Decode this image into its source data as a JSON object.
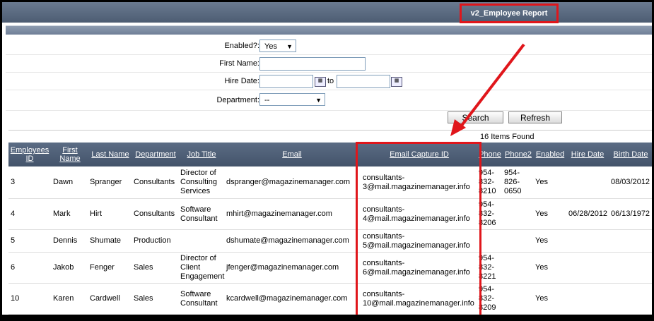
{
  "header": {
    "title": "v2_Employee Report"
  },
  "filters": {
    "enabled_label": "Enabled?:",
    "enabled_value": "Yes",
    "first_name_label": "First Name:",
    "first_name_value": "",
    "hire_date_label": "Hire Date:",
    "hire_date_from": "",
    "hire_date_to_label": "to",
    "hire_date_to": "",
    "department_label": "Department:",
    "department_value": "--"
  },
  "actions": {
    "search_label": "Search",
    "refresh_label": "Refresh"
  },
  "results": {
    "count_text": "16 Items Found"
  },
  "table": {
    "columns": [
      "Employees ID",
      "First Name",
      "Last Name",
      "Department",
      "Job Title",
      "Email",
      "Email Capture ID",
      "Phone",
      "Phone2",
      "Enabled",
      "Hire Date",
      "Birth Date"
    ],
    "rows": [
      [
        "3",
        "Dawn",
        "Spranger",
        "Consultants",
        "Director of Consulting Services",
        "dspranger@magazinemanager.com",
        "consultants-3@mail.magazinemanager.info",
        "954-832-8210",
        "954-826-0650",
        "Yes",
        "",
        "08/03/2012"
      ],
      [
        "4",
        "Mark",
        "Hirt",
        "Consultants",
        "Software Consultant",
        "mhirt@magazinemanager.com",
        "consultants-4@mail.magazinemanager.info",
        "954-832-8206",
        "",
        "Yes",
        "06/28/2012",
        "06/13/1972"
      ],
      [
        "5",
        "Dennis",
        "Shumate",
        "Production",
        "",
        "dshumate@magazinemanager.com",
        "consultants-5@mail.magazinemanager.info",
        "",
        "",
        "Yes",
        "",
        ""
      ],
      [
        "6",
        "Jakob",
        "Fenger",
        "Sales",
        "Director of Client Engagement",
        "jfenger@magazinemanager.com",
        "consultants-6@mail.magazinemanager.info",
        "954-832-8221",
        "",
        "Yes",
        "",
        ""
      ],
      [
        "10",
        "Karen",
        "Cardwell",
        "Sales",
        "Software Consultant",
        "kcardwell@magazinemanager.com",
        "consultants-10@mail.magazinemanager.info",
        "954-832-8209",
        "",
        "Yes",
        "",
        ""
      ]
    ]
  },
  "colors": {
    "annotation": "#e0161b",
    "header_bg": "#4d5c72"
  }
}
